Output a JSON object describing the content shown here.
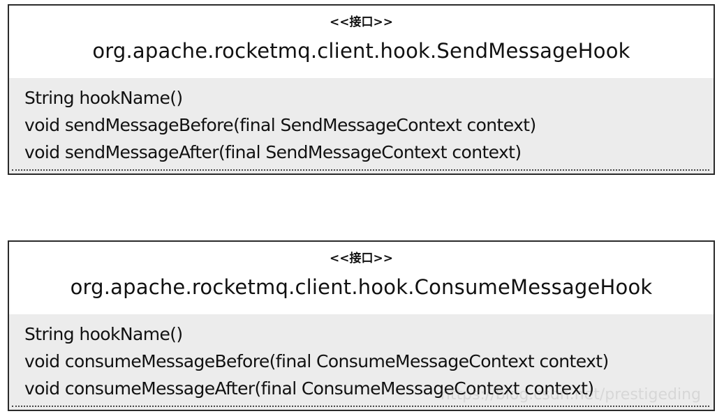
{
  "interfaces": [
    {
      "stereotype": "<<接口>>",
      "name": "org.apache.rocketmq.client.hook.SendMessageHook",
      "methods": [
        "String hookName()",
        "void sendMessageBefore(final SendMessageContext context)",
        "void sendMessageAfter(final SendMessageContext context)"
      ]
    },
    {
      "stereotype": "<<接口>>",
      "name": "org.apache.rocketmq.client.hook.ConsumeMessageHook",
      "methods": [
        "String hookName()",
        "void consumeMessageBefore(final ConsumeMessageContext context)",
        "void consumeMessageAfter(final ConsumeMessageContext context)"
      ]
    }
  ],
  "watermark": "https://blog.csdn.net/prestigeding"
}
